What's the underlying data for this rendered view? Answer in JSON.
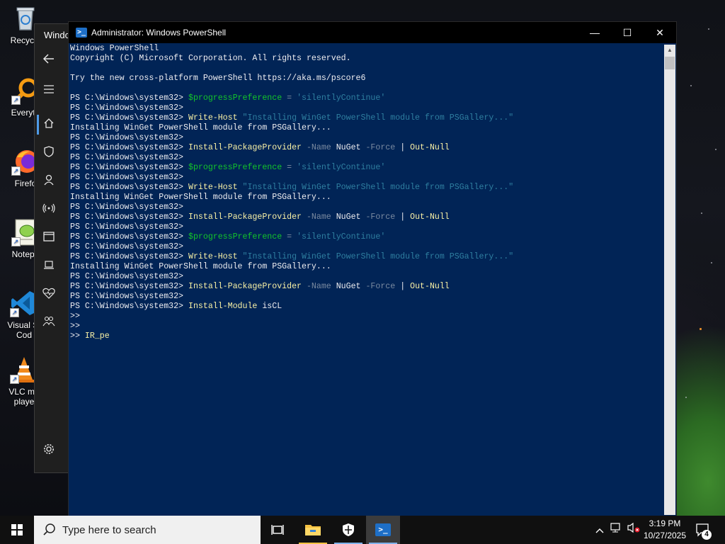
{
  "desktop": {
    "icons": [
      {
        "label": "Recycle",
        "icon": "recycle-bin-icon"
      },
      {
        "label": "Everyth",
        "icon": "everything-search-icon"
      },
      {
        "label": "Firefo",
        "icon": "firefox-icon"
      },
      {
        "label": "Notepa",
        "icon": "notepad-plus-plus-icon"
      },
      {
        "label": "Visual St\nCod",
        "line1": "Visual St",
        "line2": "Cod",
        "icon": "vscode-icon"
      },
      {
        "label": "VLC me\nplaye",
        "line1": "VLC me",
        "line2": "playe",
        "icon": "vlc-icon"
      }
    ]
  },
  "settings_window": {
    "title": "Windo",
    "nav_icons": [
      "back-arrow-icon",
      "hamburger-menu-icon",
      "home-icon",
      "shield-icon",
      "account-icon",
      "wireless-icon",
      "window-icon",
      "laptop-icon",
      "heart-icon",
      "family-icon",
      "gear-icon"
    ]
  },
  "powershell": {
    "title": "Administrator: Windows PowerShell",
    "controls": {
      "minimize": "—",
      "maximize": "☐",
      "close": "✕"
    },
    "lines": [
      [
        {
          "t": "Windows PowerShell",
          "c": "arg"
        }
      ],
      [
        {
          "t": "Copyright (C) Microsoft Corporation. All rights reserved.",
          "c": "arg"
        }
      ],
      [
        {
          "t": "",
          "c": "arg"
        }
      ],
      [
        {
          "t": "Try the new cross-platform PowerShell https://aka.ms/pscore6",
          "c": "arg"
        }
      ],
      [
        {
          "t": "",
          "c": "arg"
        }
      ],
      [
        {
          "t": "PS C:\\Windows\\system32> ",
          "c": "arg"
        },
        {
          "t": "$progressPreference",
          "c": "var"
        },
        {
          "t": " = ",
          "c": "param"
        },
        {
          "t": "'silentlyContinue'",
          "c": "str"
        }
      ],
      [
        {
          "t": "PS C:\\Windows\\system32>",
          "c": "arg"
        }
      ],
      [
        {
          "t": "PS C:\\Windows\\system32> ",
          "c": "arg"
        },
        {
          "t": "Write-Host",
          "c": "cmd"
        },
        {
          "t": " ",
          "c": "arg"
        },
        {
          "t": "\"Installing WinGet PowerShell module from PSGallery...\"",
          "c": "str"
        }
      ],
      [
        {
          "t": "Installing WinGet PowerShell module from PSGallery...",
          "c": "arg"
        }
      ],
      [
        {
          "t": "PS C:\\Windows\\system32>",
          "c": "arg"
        }
      ],
      [
        {
          "t": "PS C:\\Windows\\system32> ",
          "c": "arg"
        },
        {
          "t": "Install-PackageProvider",
          "c": "cmd"
        },
        {
          "t": " -Name ",
          "c": "param"
        },
        {
          "t": "NuGet",
          "c": "arg"
        },
        {
          "t": " -Force ",
          "c": "param"
        },
        {
          "t": "| ",
          "c": "pipe"
        },
        {
          "t": "Out-Null",
          "c": "cmd"
        }
      ],
      [
        {
          "t": "PS C:\\Windows\\system32>",
          "c": "arg"
        }
      ],
      [
        {
          "t": "PS C:\\Windows\\system32> ",
          "c": "arg"
        },
        {
          "t": "$progressPreference",
          "c": "var"
        },
        {
          "t": " = ",
          "c": "param"
        },
        {
          "t": "'silentlyContinue'",
          "c": "str"
        }
      ],
      [
        {
          "t": "PS C:\\Windows\\system32>",
          "c": "arg"
        }
      ],
      [
        {
          "t": "PS C:\\Windows\\system32> ",
          "c": "arg"
        },
        {
          "t": "Write-Host",
          "c": "cmd"
        },
        {
          "t": " ",
          "c": "arg"
        },
        {
          "t": "\"Installing WinGet PowerShell module from PSGallery...\"",
          "c": "str"
        }
      ],
      [
        {
          "t": "Installing WinGet PowerShell module from PSGallery...",
          "c": "arg"
        }
      ],
      [
        {
          "t": "PS C:\\Windows\\system32>",
          "c": "arg"
        }
      ],
      [
        {
          "t": "PS C:\\Windows\\system32> ",
          "c": "arg"
        },
        {
          "t": "Install-PackageProvider",
          "c": "cmd"
        },
        {
          "t": " -Name ",
          "c": "param"
        },
        {
          "t": "NuGet",
          "c": "arg"
        },
        {
          "t": " -Force ",
          "c": "param"
        },
        {
          "t": "| ",
          "c": "pipe"
        },
        {
          "t": "Out-Null",
          "c": "cmd"
        }
      ],
      [
        {
          "t": "PS C:\\Windows\\system32>",
          "c": "arg"
        }
      ],
      [
        {
          "t": "PS C:\\Windows\\system32> ",
          "c": "arg"
        },
        {
          "t": "$progressPreference",
          "c": "var"
        },
        {
          "t": " = ",
          "c": "param"
        },
        {
          "t": "'silentlyContinue'",
          "c": "str"
        }
      ],
      [
        {
          "t": "PS C:\\Windows\\system32>",
          "c": "arg"
        }
      ],
      [
        {
          "t": "PS C:\\Windows\\system32> ",
          "c": "arg"
        },
        {
          "t": "Write-Host",
          "c": "cmd"
        },
        {
          "t": " ",
          "c": "arg"
        },
        {
          "t": "\"Installing WinGet PowerShell module from PSGallery...\"",
          "c": "str"
        }
      ],
      [
        {
          "t": "Installing WinGet PowerShell module from PSGallery...",
          "c": "arg"
        }
      ],
      [
        {
          "t": "PS C:\\Windows\\system32>",
          "c": "arg"
        }
      ],
      [
        {
          "t": "PS C:\\Windows\\system32> ",
          "c": "arg"
        },
        {
          "t": "Install-PackageProvider",
          "c": "cmd"
        },
        {
          "t": " -Name ",
          "c": "param"
        },
        {
          "t": "NuGet",
          "c": "arg"
        },
        {
          "t": " -Force ",
          "c": "param"
        },
        {
          "t": "| ",
          "c": "pipe"
        },
        {
          "t": "Out-Null",
          "c": "cmd"
        }
      ],
      [
        {
          "t": "PS C:\\Windows\\system32>",
          "c": "arg"
        }
      ],
      [
        {
          "t": "PS C:\\Windows\\system32> ",
          "c": "arg"
        },
        {
          "t": "Install-Module",
          "c": "cmd"
        },
        {
          "t": " isCL",
          "c": "arg"
        }
      ],
      [
        {
          "t": ">>",
          "c": "arg"
        }
      ],
      [
        {
          "t": ">>",
          "c": "arg"
        }
      ],
      [
        {
          "t": ">> ",
          "c": "arg"
        },
        {
          "t": "IR_pe",
          "c": "cmd"
        }
      ]
    ],
    "colors": {
      "background": "#012456",
      "var": "#13c52a",
      "str": "#2f7fa0",
      "cmd": "#f9f1a5",
      "param": "#7a8aa0"
    }
  },
  "taskbar": {
    "search_placeholder": "Type here to search",
    "apps": [
      "task-view-icon",
      "file-explorer-icon",
      "windows-security-icon",
      "powershell-icon"
    ],
    "active_app": "powershell-icon",
    "clock_time": "3:19 PM",
    "clock_date": "10/27/2025",
    "notification_count": "4"
  }
}
